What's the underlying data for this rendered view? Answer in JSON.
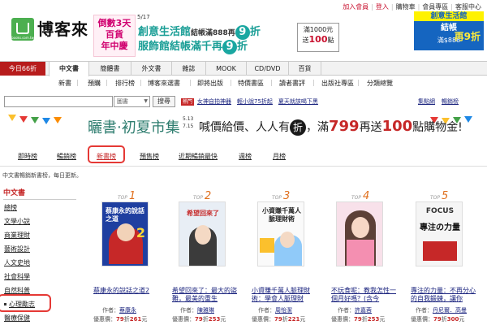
{
  "top_links": [
    "加入會員",
    "登入",
    "購物車",
    "會員專區",
    "客服中心"
  ],
  "logo": {
    "sub": "books.com.tw",
    "name": "博客來"
  },
  "promo": {
    "badge1": "倒數3天",
    "badge2": "百貨",
    "badge3": "年中慶",
    "date": "5/17",
    "line1_a": "創意生活館",
    "line1_b": "結帳滿888再",
    "line1_nine": "9",
    "line1_c": "折",
    "line2_a": "服飾館結帳滿千再",
    "line2_nine": "9",
    "line2_b": "折",
    "box1": "滿1000元",
    "box2": "送",
    "box3": "100",
    "box4": "點",
    "right_1": "創意生活館",
    "right_2": "結帳",
    "right_3": "滿$888",
    "right_4": "再9折"
  },
  "nav": {
    "today": "今日66折",
    "tabs": [
      "中文書",
      "簡體書",
      "外文書",
      "雜誌",
      "MOOK",
      "CD/DVD",
      "百貨"
    ],
    "sub": [
      "新書",
      "預購",
      "排行榜",
      "博客來選書",
      "即將出版",
      "特價書區",
      "讀者書評",
      "出版社專區",
      "分類總覽"
    ]
  },
  "search": {
    "value": "",
    "category": "圖書",
    "button": "搜尋"
  },
  "hot": {
    "label": "熱門",
    "links": [
      "女神自拍神器",
      "輕小說75折起",
      "夏天就該喝下黑"
    ]
  },
  "right_links": [
    "集點網",
    "暢銷榜"
  ],
  "banner": {
    "a": "曬書‧初夏市集",
    "date1": "5.13",
    "date2": "7.15",
    "b": "喊價給價、人人有",
    "bubble": "折",
    "c": "，滿",
    "n1": "799",
    "d": "再送",
    "n2": "100",
    "e": "點購物金!"
  },
  "cattabs": [
    "即時榜",
    "暢銷榜",
    "新書榜",
    "預售榜",
    "近期暢銷最快",
    "週榜",
    "月榜"
  ],
  "crumb": "中文書暢銷新書榜，每日更新。",
  "sidebar": {
    "title": "中文書",
    "items": [
      "總榜",
      "文學小說",
      "商業理財",
      "藝術設計",
      "人文史地",
      "社會科學",
      "自然科普",
      "心理勵志",
      "醫療保健"
    ]
  },
  "books": [
    {
      "rank": "1",
      "top": "TOP",
      "title": "蔡康永的說話之道2",
      "author_label": "作者：",
      "author": "蔡康永",
      "price_label": "優惠價：",
      "disc": "79",
      "disc_unit": "折",
      "price": "261",
      "price_unit": "元",
      "cover_text": "蔡康永的說話之道",
      "cover_num": "2"
    },
    {
      "rank": "2",
      "top": "TOP",
      "title": "希望回來了：最大的盜難，最美的重生",
      "author_label": "作者：",
      "author": "陳雅琳",
      "price_label": "優惠價：",
      "disc": "79",
      "disc_unit": "折",
      "price": "253",
      "price_unit": "元",
      "cover_text": "希望回來了",
      "cover_num": ""
    },
    {
      "rank": "3",
      "top": "TOP",
      "title": "小資賺千萬人脈理財術：學會人脈理財",
      "author_label": "作者：",
      "author": "周怡潔",
      "price_label": "優惠價：",
      "disc": "79",
      "disc_unit": "折",
      "price": "221",
      "price_unit": "元",
      "cover_text": "小資賺千萬人脈理財術",
      "cover_num": ""
    },
    {
      "rank": "4",
      "top": "TOP",
      "title": "不玩食呢：教我怎性一個月好嗎？(含今",
      "author_label": "作者：",
      "author": "許嘉蓉",
      "price_label": "優惠價：",
      "disc": "79",
      "disc_unit": "折",
      "price": "253",
      "price_unit": "元",
      "cover_text": "",
      "cover_num": ""
    },
    {
      "rank": "5",
      "top": "TOP",
      "title": "專注的力量：不再分心的自我鍛鍊，讓你",
      "author_label": "作者：",
      "author": "丹尼爾．高曼",
      "price_label": "優惠價：",
      "disc": "79",
      "disc_unit": "折",
      "price": "300",
      "price_unit": "元",
      "cover_text": "專注の力量",
      "cover_num": "FOCUS"
    }
  ],
  "colors": {
    "red": "#c62828",
    "teal": "#1a9e96",
    "nav_red": "#b71c1c",
    "link": "#1a237e",
    "orange": "#e0701e"
  }
}
